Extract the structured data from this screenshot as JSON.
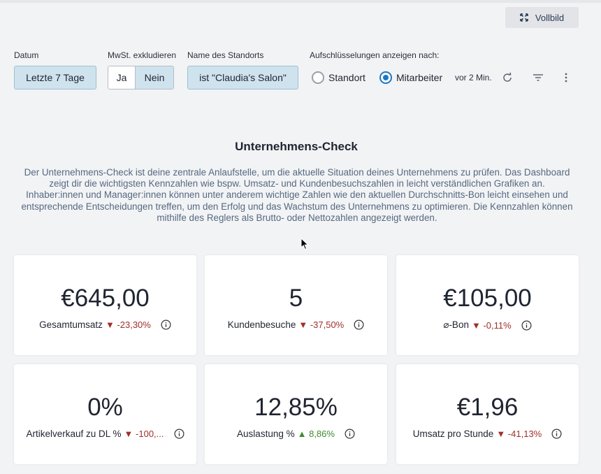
{
  "toolbar": {
    "fullscreen_label": "Vollbild"
  },
  "filters": {
    "date": {
      "label": "Datum",
      "value": "Letzte 7 Tage"
    },
    "vat": {
      "label": "MwSt. exkludieren",
      "options": [
        "Ja",
        "Nein"
      ],
      "selected": "Nein"
    },
    "location": {
      "label": "Name des Standorts",
      "value": "ist \"Claudia's Salon\""
    },
    "breakdown": {
      "label": "Aufschlüsselungen anzeigen nach:",
      "options": [
        {
          "label": "Standort",
          "selected": false
        },
        {
          "label": "Mitarbeiter",
          "selected": true
        }
      ]
    },
    "updated": "vor 2 Min."
  },
  "main": {
    "title": "Unternehmens-Check",
    "description": "Der Unternehmens-Check ist deine zentrale Anlaufstelle, um die aktuelle Situation deines Unternehmens zu prüfen. Das Dashboard zeigt dir die wichtigsten Kennzahlen wie bspw. Umsatz- und Kundenbesuchszahlen in leicht verständlichen Grafiken an. Inhaber:innen und Manager:innen können unter anderem wichtige Zahlen wie den aktuellen Durchschnitts-Bon leicht einsehen und entsprechende Entscheidungen treffen, um den Erfolg und das Wachstum des Unternehmens zu optimieren. Die Kennzahlen können mithilfe des Reglers als Brutto- oder Nettozahlen angezeigt werden."
  },
  "cards": [
    {
      "value": "€645,00",
      "label": "Gesamtumsatz",
      "change": "▼ -23,30%",
      "direction": "down"
    },
    {
      "value": "5",
      "label": "Kundenbesuche",
      "change": "▼ -37,50%",
      "direction": "down"
    },
    {
      "value": "€105,00",
      "label": "⌀-Bon",
      "change": "▼ -0,11%",
      "direction": "down"
    },
    {
      "value": "0%",
      "label": "Artikelverkauf zu DL %",
      "change": "▼ -100,...",
      "direction": "down"
    },
    {
      "value": "12,85%",
      "label": "Auslastung %",
      "change": "▲ 8,86%",
      "direction": "up"
    },
    {
      "value": "€1,96",
      "label": "Umsatz pro Stunde",
      "change": "▼ -41,13%",
      "direction": "down"
    }
  ],
  "colors": {
    "accent": "#1c78c0",
    "selected_bg": "#cfe3ee",
    "down": "#a0302a",
    "up": "#3f8a2e",
    "description": "#55697f"
  }
}
